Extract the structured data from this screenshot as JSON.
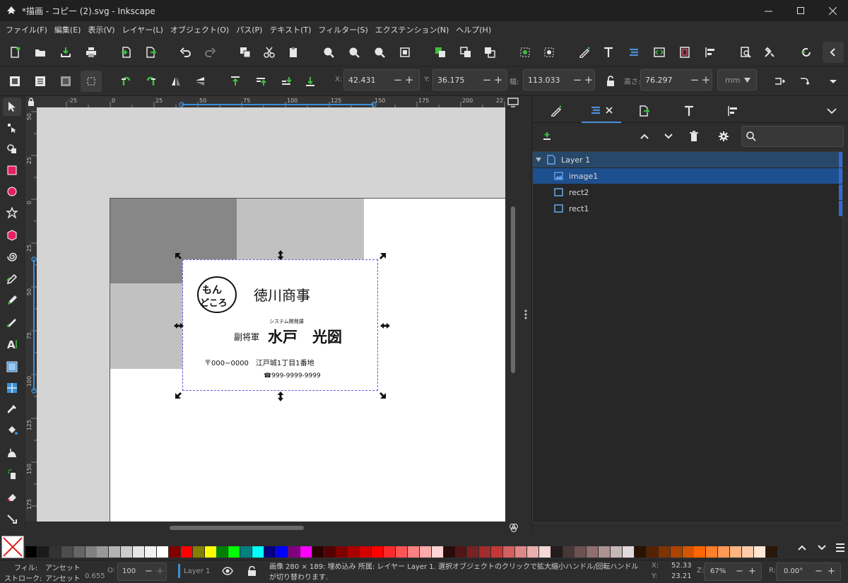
{
  "window": {
    "title": "*描画 - コピー (2).svg - Inkscape",
    "minimize": "─",
    "maximize": "☐",
    "close": "✕"
  },
  "menu": [
    "ファイル(F)",
    "編集(E)",
    "表示(V)",
    "レイヤー(L)",
    "オブジェクト(O)",
    "パス(P)",
    "テキスト(T)",
    "フィルター(S)",
    "エクステンション(N)",
    "ヘルプ(H)"
  ],
  "toolcontrols": {
    "x_label": "X:",
    "x_value": "42.431",
    "y_label": "Y:",
    "y_value": "36.175",
    "w_label": "幅:",
    "w_value": "113.033",
    "h_label": "高さ:",
    "h_value": "76.297",
    "unit": "mm",
    "minus": "−",
    "plus": "+"
  },
  "ruler_top": [
    "-25",
    "0",
    "25",
    "50",
    "75",
    "100",
    "125",
    "150",
    "175",
    "200",
    "22"
  ],
  "ruler_left": [
    "50",
    "25",
    "0",
    "25",
    "50",
    "75",
    "100",
    "125",
    "150",
    "175"
  ],
  "card": {
    "logo_top": "もん",
    "logo_bottom": "どころ",
    "company": "徳川商事",
    "department": "システム開発課",
    "title": "副将軍",
    "name": "水戸　光圀",
    "address": "〒000−0000　江戸城1丁目1番地",
    "phone": "☎999-9999-9999"
  },
  "layers": {
    "layer": "Layer 1",
    "items": [
      "image1",
      "rect2",
      "rect1"
    ]
  },
  "status": {
    "fill_label": "フィル:",
    "fill_value": "アンセット",
    "stroke_label": "ストローク:",
    "stroke_value": "アンセット",
    "stroke_width": "0.655",
    "opacity_label": "O:",
    "opacity_value": "100",
    "layer": "Layer 1",
    "message": "画像 280 × 189: 埋め込み 所属: レイヤー Layer 1. 選択オブジェクトのクリックで拡大縮小ハンドル/回転ハンドルが切り替わります.",
    "x_label": "X:",
    "x_value": "52.33",
    "y_label": "Y:",
    "y_value": "23.21",
    "zoom_label": "Z:",
    "zoom_value": "67%",
    "rotate_label": "R:",
    "rotate_value": "0.00°"
  },
  "palette": [
    "#000000",
    "#1a1a1a",
    "#333333",
    "#4d4d4d",
    "#666666",
    "#808080",
    "#999999",
    "#b3b3b3",
    "#cccccc",
    "#e6e6e6",
    "#f2f2f2",
    "#ffffff",
    "#800000",
    "#ff0000",
    "#808000",
    "#ffff00",
    "#008000",
    "#00ff00",
    "#008080",
    "#00ffff",
    "#000080",
    "#0000ff",
    "#800080",
    "#ff00ff",
    "#2b0000",
    "#550000",
    "#800000",
    "#aa0000",
    "#d40000",
    "#ff0000",
    "#ff2a2a",
    "#ff5555",
    "#ff8080",
    "#ffaaaa",
    "#ffd5d5",
    "#280b0b",
    "#501616",
    "#782121",
    "#a02c2c",
    "#c83737",
    "#d35f5f",
    "#de8787",
    "#e9afaf",
    "#f4d7d7",
    "#241c1c",
    "#483737",
    "#6c5353",
    "#916f6f",
    "#ac9393",
    "#c8b7b7",
    "#e3dbdb",
    "#2b1100",
    "#552200",
    "#803300",
    "#aa4400",
    "#d45500",
    "#ff6600",
    "#ff7f2a",
    "#ff9955",
    "#ffb380",
    "#ffccaa",
    "#ffe6d5",
    "#28170b"
  ]
}
